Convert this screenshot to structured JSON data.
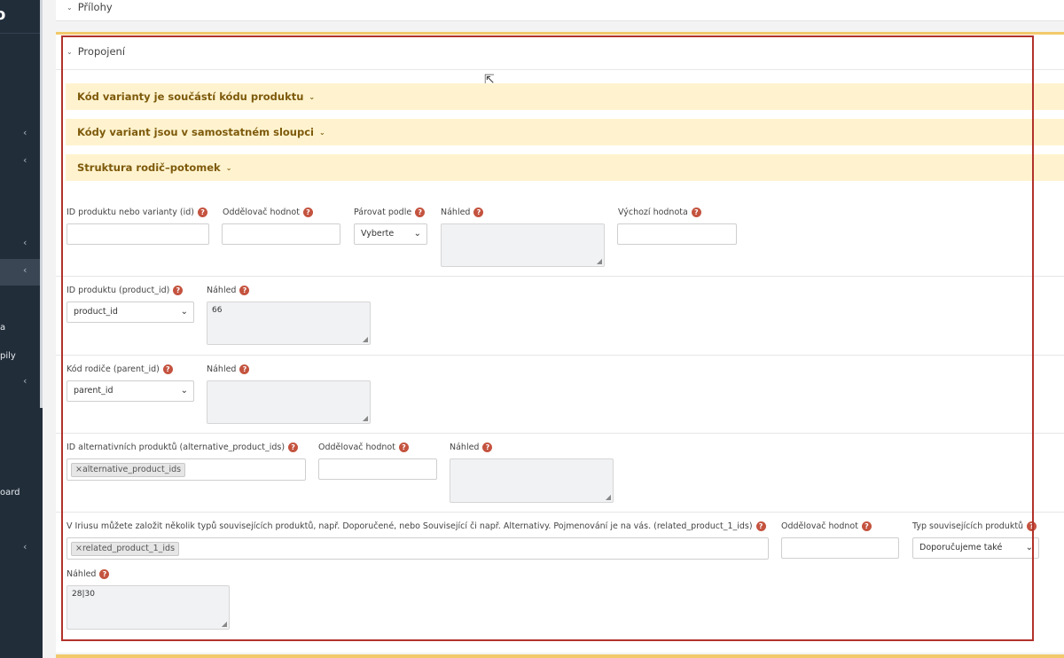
{
  "sidebar": {
    "logo_small": "e",
    "logo_letter": "o",
    "items": [
      "a",
      "pily",
      "oard"
    ]
  },
  "sections": {
    "prilohy": "Přílohy",
    "propojeni": "Propojení"
  },
  "bands": [
    "Kód varianty je součástí kódu produktu",
    "Kódy variant jsou v samostatném sloupci",
    "Struktura rodič–potomek"
  ],
  "row1": {
    "id_label": "ID produktu nebo varianty (id)",
    "separator_label": "Oddělovač hodnot",
    "pair_label": "Párovat podle",
    "pair_value": "Vyberte",
    "preview_label": "Náhled",
    "default_label": "Výchozí hodnota"
  },
  "row2": {
    "label": "ID produktu (product_id)",
    "select_value": "product_id",
    "preview_label": "Náhled",
    "preview_value": "66"
  },
  "row3": {
    "label": "Kód rodiče (parent_id)",
    "select_value": "parent_id",
    "preview_label": "Náhled",
    "preview_value": ""
  },
  "row4": {
    "label": "ID alternativních produktů (alternative_product_ids)",
    "tag": "×alternative_product_ids",
    "separator_label": "Oddělovač hodnot",
    "preview_label": "Náhled"
  },
  "row5": {
    "label": "V Iriusu můžete založit několik typů souvisejících produktů, např. Doporučené, nebo Související či např. Alternativy. Pojmenování je na vás. (related_product_1_ids)",
    "tag": "×related_product_1_ids",
    "separator_label": "Oddělovač hodnot",
    "type_label": "Typ souvisejících produktů",
    "type_value": "Doporučujeme také",
    "preview_label": "Náhled",
    "preview_value": "28|30"
  },
  "icons": {
    "help": "?",
    "chevron_left": "‹",
    "chevron_down": "⌄"
  },
  "colors": {
    "band_bg": "#fff3cf",
    "band_text": "#7d5a0b",
    "help_icon": "#c4533f",
    "highlight_border": "#b2322a",
    "sidebar_bg": "#222d3a"
  }
}
